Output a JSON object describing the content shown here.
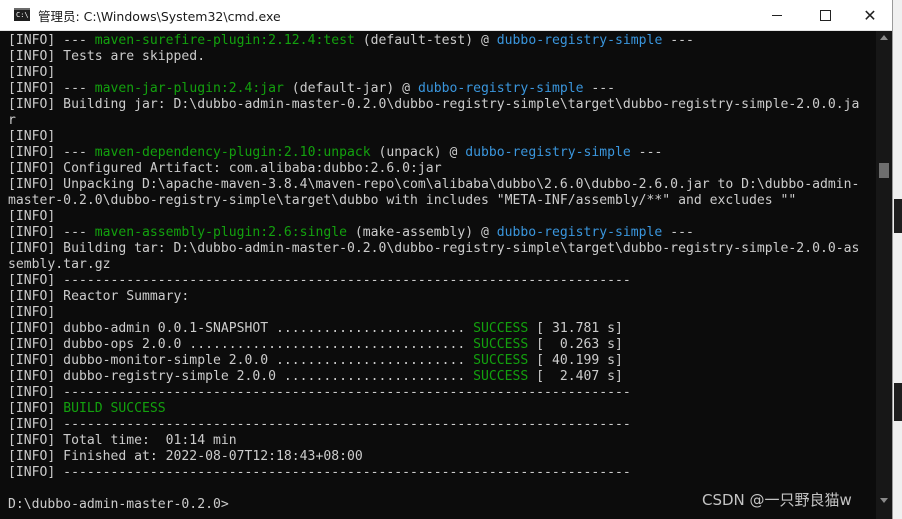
{
  "window": {
    "title": "管理员: C:\\Windows\\System32\\cmd.exe",
    "icon": "cmd-icon",
    "icon_text": "C:\\",
    "controls": {
      "minimize": "minimize-icon",
      "maximize": "maximize-icon",
      "close": "✕"
    }
  },
  "colors": {
    "background": "#0c0c0c",
    "text": "#cccccc",
    "blue": "#3a96dd",
    "green": "#13a10e"
  },
  "console_lines": [
    [
      {
        "t": "[INFO] --- ",
        "c": "white"
      },
      {
        "t": "maven-surefire-plugin:2.12.4:test",
        "c": "green"
      },
      {
        "t": " (default-test) @ ",
        "c": "white"
      },
      {
        "t": "dubbo-registry-simple",
        "c": "blue"
      },
      {
        "t": " ---",
        "c": "white"
      }
    ],
    [
      {
        "t": "[INFO] Tests are skipped.",
        "c": "white"
      }
    ],
    [
      {
        "t": "[INFO]",
        "c": "white"
      }
    ],
    [
      {
        "t": "[INFO] --- ",
        "c": "white"
      },
      {
        "t": "maven-jar-plugin:2.4:jar",
        "c": "green"
      },
      {
        "t": " (default-jar) @ ",
        "c": "white"
      },
      {
        "t": "dubbo-registry-simple",
        "c": "blue"
      },
      {
        "t": " ---",
        "c": "white"
      }
    ],
    [
      {
        "t": "[INFO] Building jar: D:\\dubbo-admin-master-0.2.0\\dubbo-registry-simple\\target\\dubbo-registry-simple-2.0.0.ja",
        "c": "white"
      }
    ],
    [
      {
        "t": "r",
        "c": "white"
      }
    ],
    [
      {
        "t": "[INFO]",
        "c": "white"
      }
    ],
    [
      {
        "t": "[INFO] --- ",
        "c": "white"
      },
      {
        "t": "maven-dependency-plugin:2.10:unpack",
        "c": "green"
      },
      {
        "t": " (unpack) @ ",
        "c": "white"
      },
      {
        "t": "dubbo-registry-simple",
        "c": "blue"
      },
      {
        "t": " ---",
        "c": "white"
      }
    ],
    [
      {
        "t": "[INFO] Configured Artifact: com.alibaba:dubbo:2.6.0:jar",
        "c": "white"
      }
    ],
    [
      {
        "t": "[INFO] Unpacking D:\\apache-maven-3.8.4\\maven-repo\\com\\alibaba\\dubbo\\2.6.0\\dubbo-2.6.0.jar to D:\\dubbo-admin-",
        "c": "white"
      }
    ],
    [
      {
        "t": "master-0.2.0\\dubbo-registry-simple\\target\\dubbo with includes \"META-INF/assembly/**\" and excludes \"\"",
        "c": "white"
      }
    ],
    [
      {
        "t": "[INFO]",
        "c": "white"
      }
    ],
    [
      {
        "t": "[INFO] --- ",
        "c": "white"
      },
      {
        "t": "maven-assembly-plugin:2.6:single",
        "c": "green"
      },
      {
        "t": " (make-assembly) @ ",
        "c": "white"
      },
      {
        "t": "dubbo-registry-simple",
        "c": "blue"
      },
      {
        "t": " ---",
        "c": "white"
      }
    ],
    [
      {
        "t": "[INFO] Building tar: D:\\dubbo-admin-master-0.2.0\\dubbo-registry-simple\\target\\dubbo-registry-simple-2.0.0-as",
        "c": "white"
      }
    ],
    [
      {
        "t": "sembly.tar.gz",
        "c": "white"
      }
    ],
    [
      {
        "t": "[INFO] ------------------------------------------------------------------------",
        "c": "white"
      }
    ],
    [
      {
        "t": "[INFO] Reactor Summary:",
        "c": "white"
      }
    ],
    [
      {
        "t": "[INFO]",
        "c": "white"
      }
    ],
    [
      {
        "t": "[INFO] dubbo-admin 0.0.1-SNAPSHOT ........................ ",
        "c": "white"
      },
      {
        "t": "SUCCESS",
        "c": "green"
      },
      {
        "t": " [ 31.781 s]",
        "c": "white"
      }
    ],
    [
      {
        "t": "[INFO] dubbo-ops 2.0.0 ................................... ",
        "c": "white"
      },
      {
        "t": "SUCCESS",
        "c": "green"
      },
      {
        "t": " [  0.263 s]",
        "c": "white"
      }
    ],
    [
      {
        "t": "[INFO] dubbo-monitor-simple 2.0.0 ........................ ",
        "c": "white"
      },
      {
        "t": "SUCCESS",
        "c": "green"
      },
      {
        "t": " [ 40.199 s]",
        "c": "white"
      }
    ],
    [
      {
        "t": "[INFO] dubbo-registry-simple 2.0.0 ....................... ",
        "c": "white"
      },
      {
        "t": "SUCCESS",
        "c": "green"
      },
      {
        "t": " [  2.407 s]",
        "c": "white"
      }
    ],
    [
      {
        "t": "[INFO] ------------------------------------------------------------------------",
        "c": "white"
      }
    ],
    [
      {
        "t": "[INFO] ",
        "c": "white"
      },
      {
        "t": "BUILD SUCCESS",
        "c": "green"
      }
    ],
    [
      {
        "t": "[INFO] ------------------------------------------------------------------------",
        "c": "white"
      }
    ],
    [
      {
        "t": "[INFO] Total time:  01:14 min",
        "c": "white"
      }
    ],
    [
      {
        "t": "[INFO] Finished at: 2022-08-07T12:18:43+08:00",
        "c": "white"
      }
    ],
    [
      {
        "t": "[INFO] ------------------------------------------------------------------------",
        "c": "white"
      }
    ],
    [
      {
        "t": "",
        "c": "white"
      }
    ],
    [
      {
        "t": "D:\\dubbo-admin-master-0.2.0>",
        "c": "white"
      }
    ]
  ],
  "watermark": "CSDN @一只野良猫w"
}
